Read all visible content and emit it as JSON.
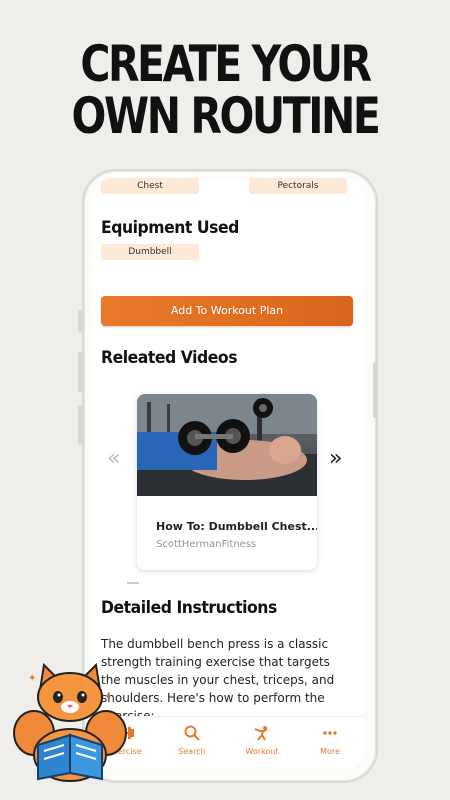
{
  "headline": {
    "line1": "CREATE YOUR",
    "line2": "OWN ROUTINE"
  },
  "muscles": {
    "primary": "Chest",
    "secondary": "Pectorals"
  },
  "equipment": {
    "title": "Equipment Used",
    "item": "Dumbbell"
  },
  "add_button": "Add To Workout Plan",
  "videos": {
    "title": "Releated Videos",
    "card": {
      "title": "How To: Dumbbell Chest...",
      "channel": "ScottHermanFitness"
    },
    "prev_arrow": "«",
    "next_arrow": "»"
  },
  "instructions": {
    "title": "Detailed Instructions",
    "text": "The dumbbell bench press is a classic strength training exercise that targets the muscles in your chest, triceps, and shoulders. Here's how to perform the exercise:"
  },
  "tabs": [
    {
      "label": "Exercise",
      "icon": "dumbbell-icon"
    },
    {
      "label": "Search",
      "icon": "search-icon"
    },
    {
      "label": "Workout",
      "icon": "workout-icon"
    },
    {
      "label": "More",
      "icon": "more-icon"
    }
  ],
  "colors": {
    "accent": "#e8792a",
    "chip_bg": "#fde9d8",
    "background": "#efeeea"
  }
}
